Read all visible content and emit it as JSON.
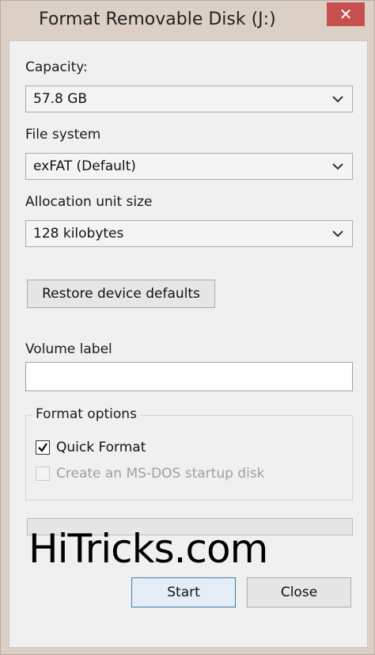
{
  "window": {
    "title": "Format Removable Disk (J:)",
    "close_glyph": "✕"
  },
  "capacity": {
    "label": "Capacity:",
    "value": "57.8 GB"
  },
  "file_system": {
    "label": "File system",
    "value": "exFAT (Default)"
  },
  "allocation": {
    "label": "Allocation unit size",
    "value": "128 kilobytes"
  },
  "restore_button": "Restore device defaults",
  "volume": {
    "label": "Volume label",
    "value": ""
  },
  "format_options": {
    "legend": "Format options",
    "quick_format": {
      "label": "Quick Format",
      "checked": true
    },
    "msdos": {
      "label": "Create an MS-DOS startup disk",
      "checked": false,
      "enabled": false
    }
  },
  "progress": 0,
  "watermark": "HiTricks.com",
  "buttons": {
    "start": "Start",
    "close": "Close"
  },
  "colors": {
    "close_button": "#c7504f",
    "focus_border": "#3c7fb1"
  }
}
